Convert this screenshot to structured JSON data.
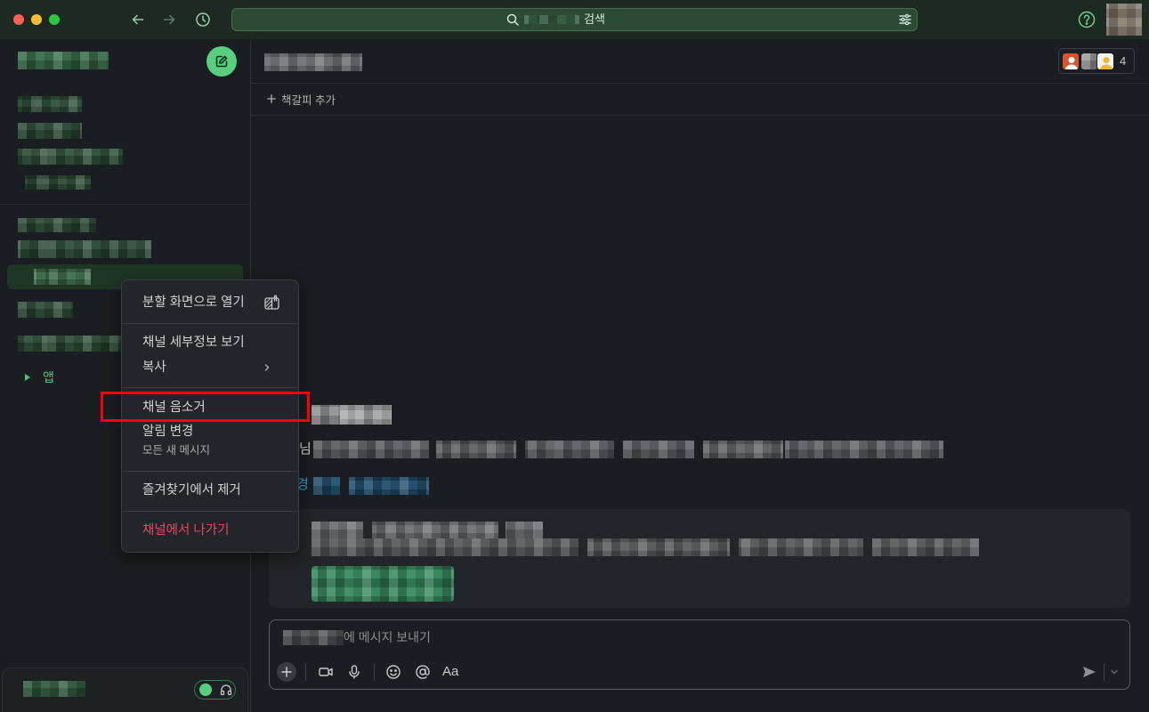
{
  "window": {
    "traffic_lights": {
      "close": "#ff5f57",
      "minimize": "#febc2e",
      "zoom": "#28c840"
    }
  },
  "titlebar": {
    "back_icon": "arrow-left-icon",
    "forward_icon": "arrow-right-icon",
    "history_icon": "clock-icon",
    "search": {
      "label": "검색",
      "icon": "search-icon",
      "filter_icon": "sliders-icon"
    },
    "help_icon": "help-circle-icon"
  },
  "sidebar": {
    "compose_icon": "compose-icon",
    "apps_section": {
      "label": "앱",
      "icon": "caret-right-icon"
    },
    "huddle_icon": "headphones-icon"
  },
  "channel_header": {
    "member_count": "4",
    "bookmark_add_label": "책갈피 추가"
  },
  "messages": {
    "intro_fragment": "님",
    "link_fragment": "경"
  },
  "composer": {
    "placeholder_suffix": "에 메시지 보내기",
    "format_label": "Aa",
    "tools": [
      "plus-icon",
      "video-icon",
      "mic-icon",
      "emoji-icon",
      "at-icon",
      "send-icon",
      "chevron-down-icon"
    ]
  },
  "context_menu": {
    "items": [
      {
        "label": "분할 화면으로 열기",
        "icon": "split-view-icon"
      },
      {
        "label": "채널 세부정보 보기"
      },
      {
        "label": "복사",
        "icon": "chevron-right-icon"
      },
      {
        "label": "채널 음소거"
      },
      {
        "label": "알림 변경",
        "sublabel": "모든 새 메시지"
      },
      {
        "label": "즐겨찾기에서 제거"
      },
      {
        "label": "채널에서 나가기"
      }
    ]
  },
  "theme": {
    "accent": "#57cf7e",
    "danger": "#e8475f",
    "link": "#1d9bd1",
    "annotation": "#ff0000"
  }
}
